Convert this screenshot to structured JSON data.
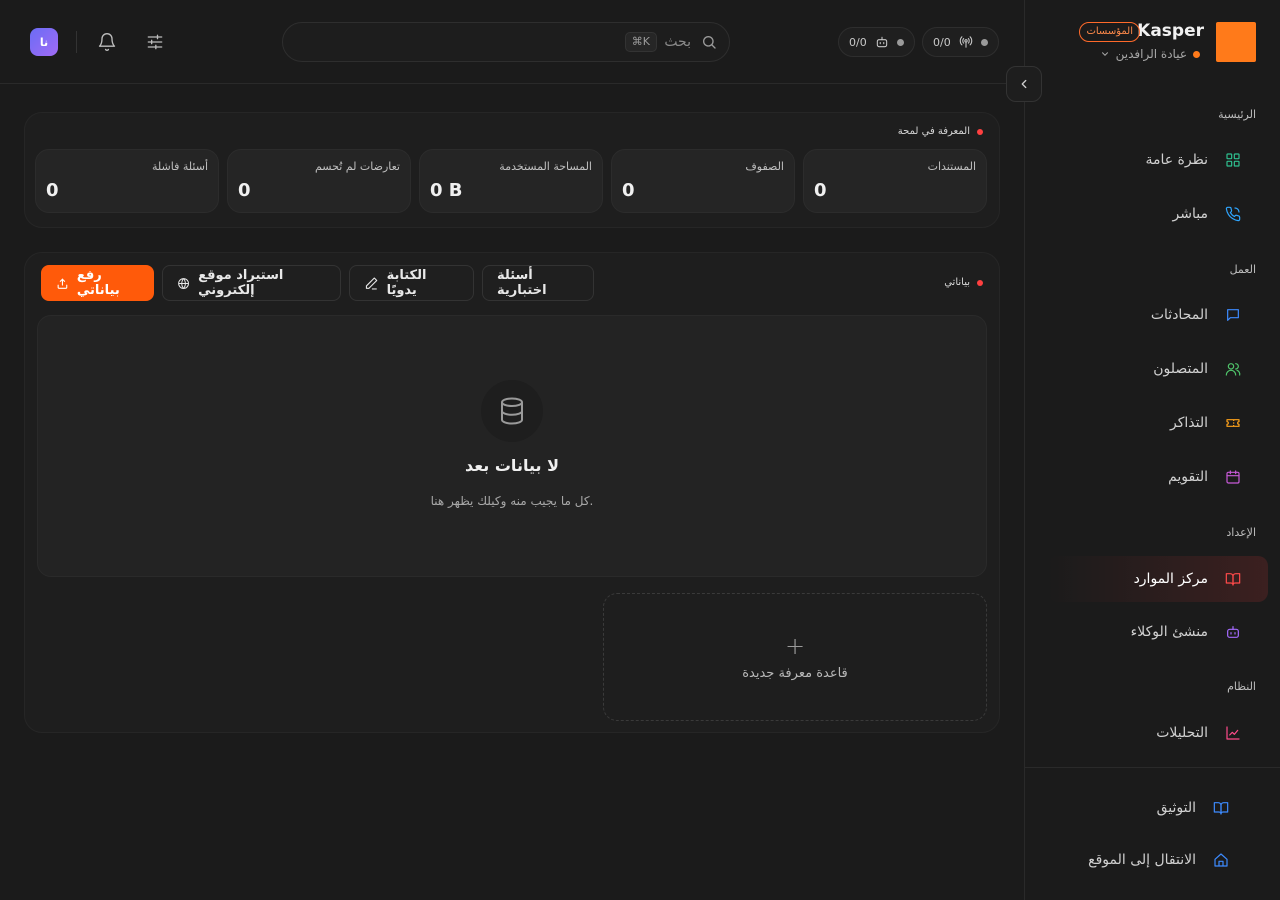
{
  "header": {
    "avatar_initials": "نا",
    "search_label": "بحث",
    "search_shortcut": "⌘K",
    "counter_bots": "0/0",
    "counter_live": "0/0"
  },
  "brand": {
    "name": "Kasper",
    "badge": "المؤسسات",
    "org": "عيادة الرافدين"
  },
  "sidebar": {
    "section_main": "الرئيسية",
    "overview": "نظرة عامة",
    "live": "مباشر",
    "section_work": "العمل",
    "conversations": "المحادثات",
    "contacts": "المتصلون",
    "tickets": "التذاكر",
    "calendar": "التقويم",
    "section_setup": "الإعداد",
    "resources": "مركز الموارد",
    "agent_builder": "منشئ الوكلاء",
    "section_system": "النظام",
    "analytics": "التحليلات",
    "docs": "التوثيق",
    "go_to_site": "الانتقال إلى الموقع"
  },
  "stats": {
    "title": "المعرفة في لمحة",
    "items": [
      {
        "label": "المستندات",
        "value": "0"
      },
      {
        "label": "الصفوف",
        "value": "0"
      },
      {
        "label": "المساحة المستخدمة",
        "value": "0 B"
      },
      {
        "label": "تعارضات لم تُحسم",
        "value": "0"
      },
      {
        "label": "أسئلة فاشلة",
        "value": "0"
      }
    ]
  },
  "data_panel": {
    "title": "بياناتي",
    "btn_test_questions": "أسئلة اختبارية",
    "btn_manual": "الكتابة يدويًا",
    "btn_import_site": "استيراد موقع إلكتروني",
    "btn_upload": "رفع بياناتي",
    "empty_title": "لا بيانات بعد",
    "empty_sub": "كل ما يجيب منه وكيلك يظهر هنا.",
    "new_kb": "قاعدة معرفة جديدة"
  },
  "colors": {
    "accent": "#ff5a0a",
    "brand_logo": "#ff7a1a",
    "status_dot": "#ff4040"
  }
}
